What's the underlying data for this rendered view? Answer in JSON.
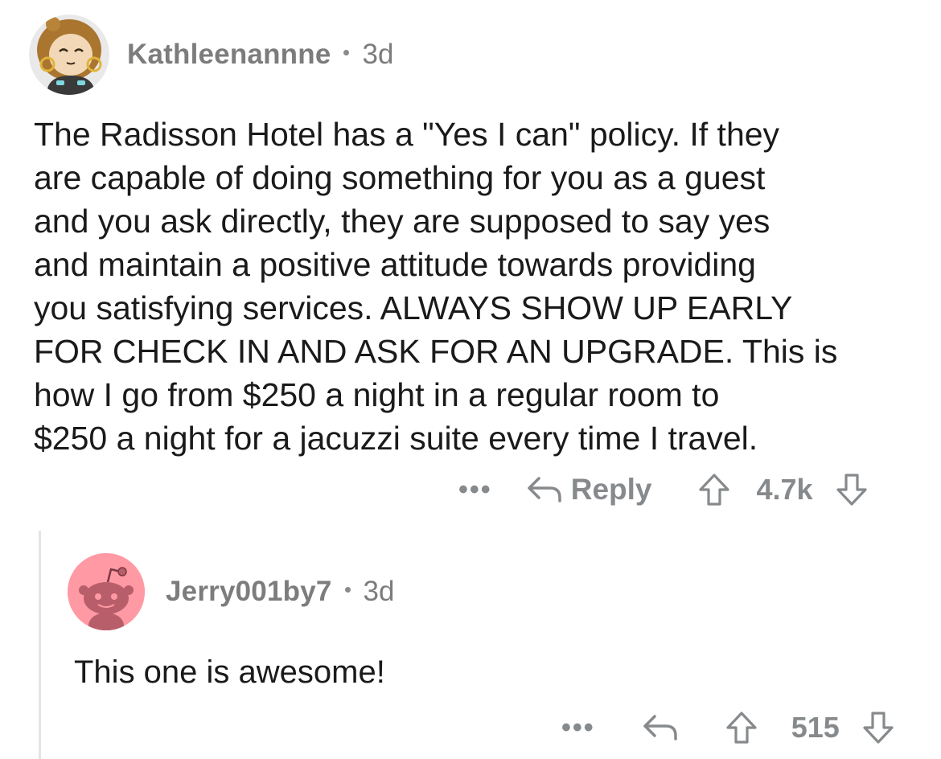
{
  "comment": {
    "username": "Kathleenannne",
    "age": "3d",
    "body": "The Radisson Hotel has a \"Yes I can\" policy. If they\nare capable of doing something for you as a guest\nand you ask directly, they are supposed to say yes\nand maintain a positive attitude towards providing\nyou satisfying services. ALWAYS SHOW UP EARLY\nFOR CHECK IN AND ASK FOR AN UPGRADE. This is\nhow I go from $250 a night in a regular room to\n$250 a night for a jacuzzi suite every time I travel.",
    "more_label": "•••",
    "reply_label": "Reply",
    "score": "4.7k"
  },
  "reply": {
    "username": "Jerry001by7",
    "age": "3d",
    "body": "This one is awesome!",
    "more_label": "•••",
    "score": "515"
  },
  "colors": {
    "meta_gray": "#7c7c7c",
    "action_gray": "#878a8c",
    "thread_line": "#e4e4e4",
    "snoo_avatar_bg": "#ff99a4"
  },
  "icons": [
    "reply-arrow-icon",
    "upvote-icon",
    "downvote-icon"
  ]
}
